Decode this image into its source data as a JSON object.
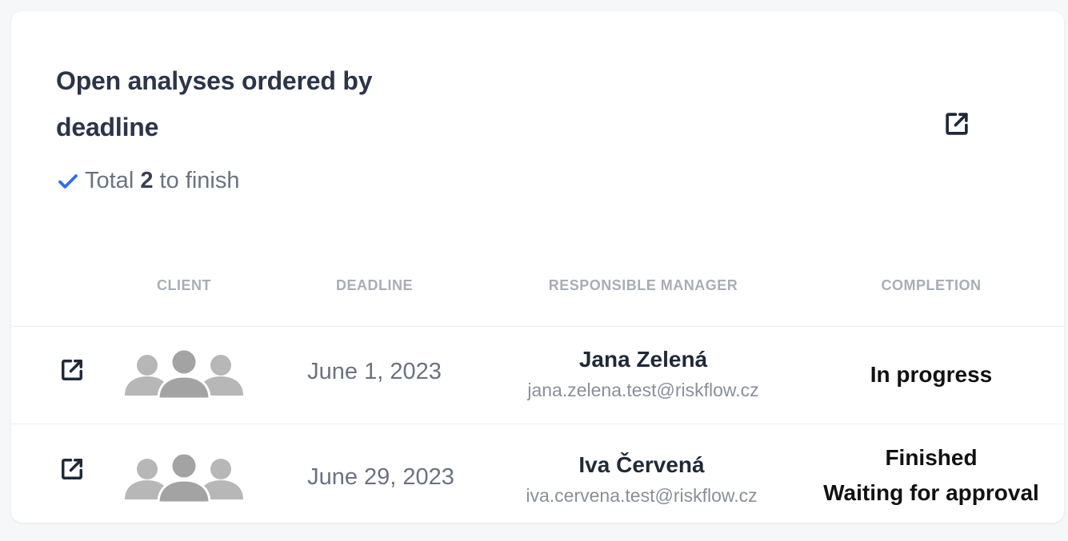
{
  "card": {
    "title": "Open analyses ordered by deadline",
    "summary_prefix": "Total ",
    "summary_count": "2",
    "summary_suffix": " to finish"
  },
  "table": {
    "columns": [
      "CLIENT",
      "DEADLINE",
      "RESPONSIBLE MANAGER",
      "COMPLETION"
    ],
    "rows": [
      {
        "deadline": "June 1, 2023",
        "manager_name": "Jana Zelená",
        "manager_email": "jana.zelena.test@riskflow.cz",
        "status_line1": "In progress",
        "status_line2": ""
      },
      {
        "deadline": "June 29, 2023",
        "manager_name": "Iva Červená",
        "manager_email": "iva.cervena.test@riskflow.cz",
        "status_line1": "Finished",
        "status_line2": "Waiting for approval"
      }
    ]
  },
  "icons": {
    "open": "open-in-new-icon",
    "check": "checkmark-icon",
    "client": "client-group-icon"
  },
  "colors": {
    "title": "#2b3549",
    "accent_check": "#2f6fed",
    "muted_text": "#6b7280",
    "header_text": "#a9adb5",
    "divider": "#eceef1"
  }
}
